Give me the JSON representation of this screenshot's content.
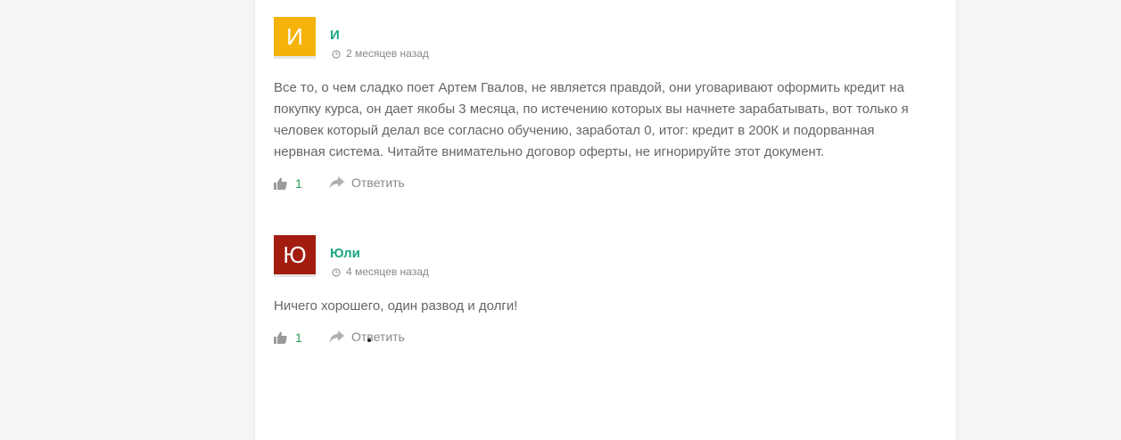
{
  "comments": [
    {
      "avatar_letter": "И",
      "avatar_color": "#f5b20a",
      "author": "И",
      "date": "2 месяцев назад",
      "text": "Все то, о чем сладко поет Артем Гвалов, не является правдой, они уговаривают оформить кредит на покупку курса, он дает якобы 3 месяца, по истечению которых вы начнете зарабатывать, вот только я человек который делал все согласно обучению, заработал 0, итог: кредит в 200К и подорванная нервная система. Читайте внимательно договор оферты, не игнорируйте этот документ.",
      "likes": "1",
      "reply_label": "Ответить"
    },
    {
      "avatar_letter": "Ю",
      "avatar_color": "#a31c10",
      "author": "Юли",
      "date": "4 месяцев назад",
      "text": "Ничего хорошего, один развод и долги!",
      "likes": "1",
      "reply_label": "Ответить"
    }
  ],
  "icons": {
    "like": "thumbs-up-icon",
    "reply": "reply-arrow-icon",
    "clock": "clock-icon"
  }
}
